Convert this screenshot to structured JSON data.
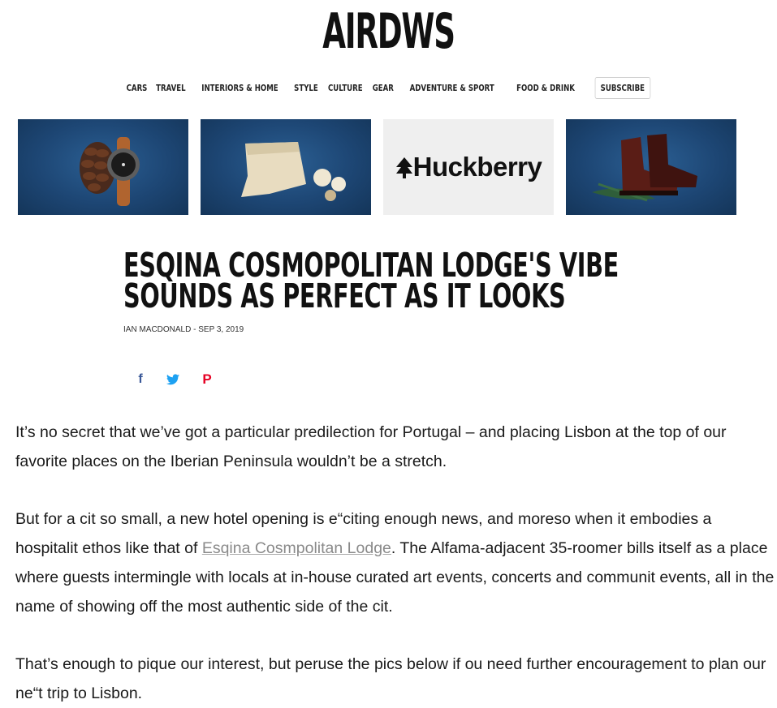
{
  "site": {
    "logo": "AIRDWS"
  },
  "nav": {
    "items": [
      "CARS",
      "TRAVEL",
      "INTERIORS & HOME",
      "STYLE",
      "CULTURE",
      "GEAR",
      "ADVENTURE & SPORT",
      "FOOD & DRINK"
    ],
    "subscribe": "SUBSCRIBE"
  },
  "ad": {
    "brand": "Huckberry",
    "brand_icon": "tree-icon"
  },
  "article": {
    "headline_line1": "ESQINA COSMOPOLITAN LODGE'S VIBE",
    "headline_line2": "SOUNDS AS PERFECT AS IT LOOKS",
    "byline": "IAN MACDONALD - SEP 3, 2019",
    "share_icons": [
      "facebook-icon",
      "twitter-icon",
      "pinterest-icon"
    ],
    "p1": "It’s no secret that we’ve got a particular predilection for Portugal – and placing Lisbon at the top of our favorite places on the Iberian Peninsula wouldn’t be a stretch.",
    "p2_before": "But for a cit so small, a new hotel opening is e“citing enough news, and moreso when it embodies a hospitalit ethos like that of ",
    "p2_link": "Esqina Cosmpolitan Lodge",
    "p2_after": ". The Alfama-adjacent 35-roomer bills itself as a place where guests intermingle with locals at in-house curated art events, concerts and communit events, all in the name of showing off the most authentic side of the cit.",
    "p3": "That’s enough to pique our interest, but peruse the pics below if ou need further encouragement to plan our ne“t trip to Lisbon."
  },
  "colors": {
    "facebook": "#3b5998",
    "twitter": "#1da1f2",
    "pinterest": "#e60023",
    "banner_blue": "#1d4674"
  }
}
